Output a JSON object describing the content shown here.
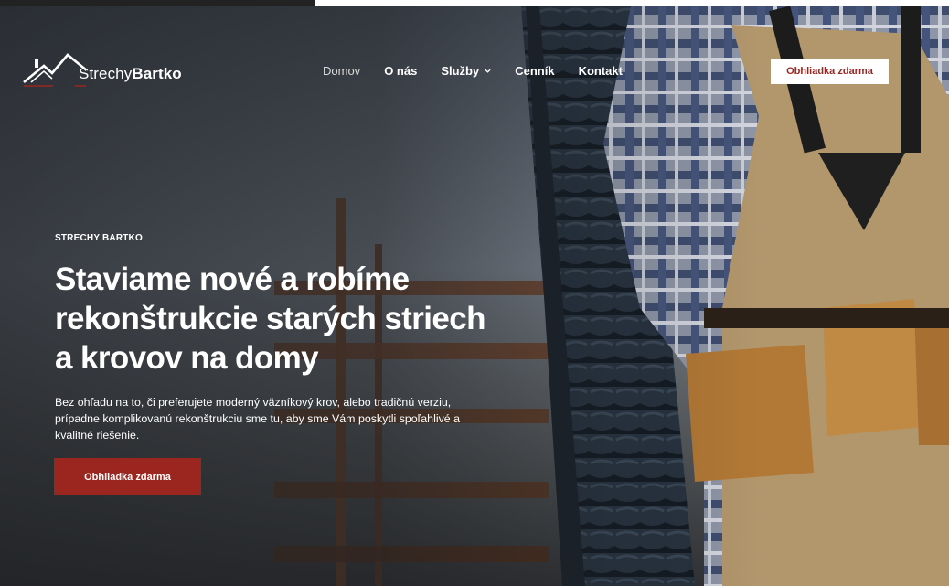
{
  "brand": {
    "name_light": "Strechy",
    "name_bold": "Bartko"
  },
  "nav": {
    "items": [
      {
        "label": "Domov",
        "active": true
      },
      {
        "label": "O nás",
        "active": false
      },
      {
        "label": "Služby",
        "active": false,
        "has_dropdown": true
      },
      {
        "label": "Cenník",
        "active": false
      },
      {
        "label": "Kontakt",
        "active": false
      }
    ],
    "cta_label": "Obhliadka zdarma"
  },
  "hero": {
    "kicker": "STRECHY BARTKO",
    "headline": "Staviame nové a robíme rekonštrukcie starých striech a krovov na domy",
    "lead": "Bez ohľadu na to, či preferujete moderný väzníkový krov, alebo tradičnú verziu, prípadne komplikovanú rekonštrukciu sme tu, aby sme Vám poskytli spoľahlivé a kvalitné riešenie.",
    "cta_label": "Obhliadka zdarma"
  },
  "colors": {
    "accent": "#9b2620",
    "accent_text": "#9a2621",
    "text_on_dark": "#ffffff"
  }
}
